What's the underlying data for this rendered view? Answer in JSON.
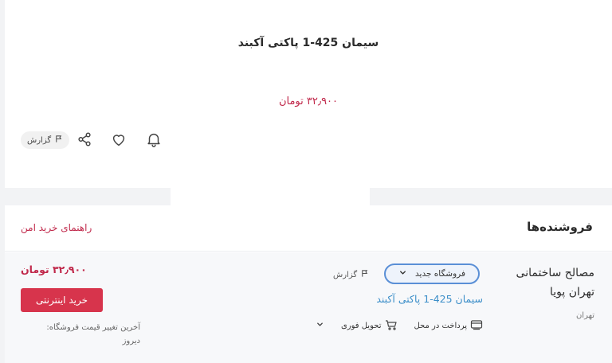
{
  "product": {
    "title": "سیمان 425-1 پاکتی آکبند",
    "price": "۳۲٫۹۰۰ تومان"
  },
  "actions": {
    "report_label": "گزارش",
    "icons": [
      "bell-icon",
      "heart-icon",
      "share-icon",
      "flag-icon"
    ]
  },
  "sellers": {
    "title": "فروشنده‌ها",
    "safe_guide": "راهنمای خرید امن",
    "items": [
      {
        "name": "مصالح ساختمانی تهران پویا",
        "city": "تهران",
        "store_badge": "فروشگاه جدید",
        "report_label": "گزارش",
        "product_title": "سیمان 425-1 پاکتی آکبند",
        "payment": "پرداخت در محل",
        "delivery": "تحویل فوری",
        "price": "۳۲٫۹۰۰ تومان",
        "buy_label": "خرید اینترنتی",
        "last_change_label": "آخرین تغییر قیمت فروشگاه:",
        "last_change_value": "دیروز"
      }
    ]
  },
  "colors": {
    "accent": "#c0284a",
    "buy_button": "#d7344c",
    "link": "#3d8fc9",
    "badge_border": "#5a8fd6"
  }
}
